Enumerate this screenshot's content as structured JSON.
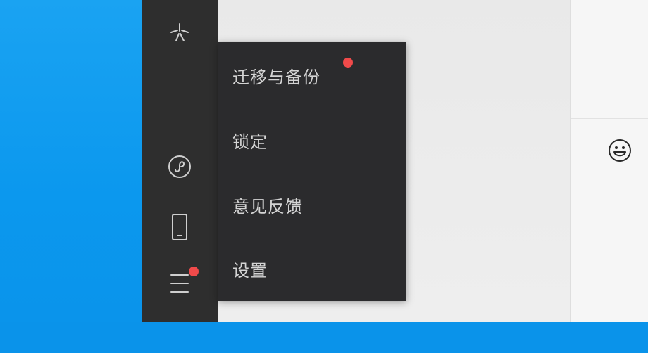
{
  "colors": {
    "desktop": "#0f9cf0",
    "sidebar": "#2e2e2e",
    "menu_bg": "#2b2b2d",
    "menu_text": "#d4d4d4",
    "badge": "#f04a4a",
    "icon_stroke": "#cfcfcf"
  },
  "sidebar": {
    "icons": [
      {
        "name": "moments-icon"
      },
      {
        "name": "mini-program-icon"
      },
      {
        "name": "phone-icon"
      },
      {
        "name": "menu-icon",
        "has_badge": true
      }
    ]
  },
  "menu": {
    "items": [
      {
        "id": "migrate-backup",
        "label": "迁移与备份",
        "has_badge": true
      },
      {
        "id": "lock",
        "label": "锁定",
        "has_badge": false
      },
      {
        "id": "feedback",
        "label": "意见反馈",
        "has_badge": false
      },
      {
        "id": "settings",
        "label": "设置",
        "has_badge": false
      }
    ]
  },
  "right_panel": {
    "emoji_icon": "emoji-icon"
  }
}
